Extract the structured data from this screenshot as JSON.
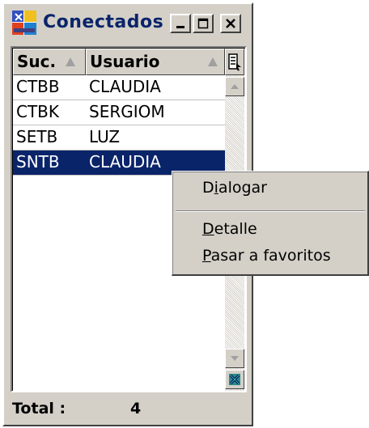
{
  "window": {
    "title": "Conectados",
    "icon": "app-grid-icon",
    "buttons": {
      "minimize": "minimize-icon",
      "maximize": "maximize-icon",
      "close": "close-icon"
    }
  },
  "grid": {
    "columns": [
      {
        "label": "Suc.",
        "sort_icon": "sort-ascending-icon"
      },
      {
        "label": "Usuario",
        "sort_icon": "sort-ascending-icon"
      }
    ],
    "column_chooser_icon": "column-chooser-icon",
    "rows": [
      {
        "suc": "CTBB",
        "usuario": "CLAUDIA",
        "selected": false
      },
      {
        "suc": "CTBK",
        "usuario": "SERGIOM",
        "selected": false
      },
      {
        "suc": "SETB",
        "usuario": "LUZ",
        "selected": false
      },
      {
        "suc": "SNTB",
        "usuario": "CLAUDIA",
        "selected": true
      }
    ],
    "scrollbar": {
      "up": "arrow-up-icon",
      "down": "arrow-down-icon",
      "extra": "clear-filter-icon"
    }
  },
  "footer": {
    "total_label": "Total :",
    "total_value": "4"
  },
  "context_menu": {
    "items": [
      {
        "label": "Dialogar",
        "mnemonic": "i"
      },
      {
        "label": "Detalle",
        "mnemonic": "D"
      },
      {
        "label": "Pasar a favoritos",
        "mnemonic": "P"
      }
    ]
  },
  "colors": {
    "selection": "#0a246a",
    "title_text": "#0a246a",
    "face": "#d4d0c8"
  }
}
